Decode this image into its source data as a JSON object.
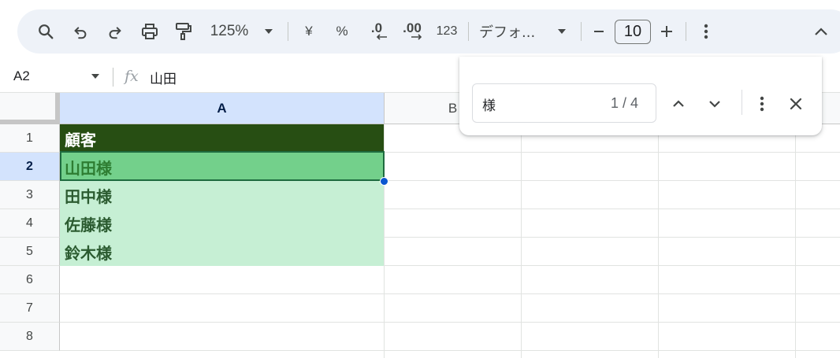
{
  "toolbar": {
    "zoom": "125%",
    "currency_label": "¥",
    "percent_label": "%",
    "decrease_decimal_label": ".0",
    "increase_decimal_label": ".00",
    "number_format_label": "123",
    "font_name": "デフォ...",
    "font_size": "10"
  },
  "formula_bar": {
    "cell_ref": "A2",
    "fx_label": "fx",
    "value": "山田"
  },
  "grid": {
    "columns": [
      "A",
      "B"
    ],
    "rows": [
      "1",
      "2",
      "3",
      "4",
      "5",
      "6",
      "7",
      "8"
    ],
    "selected_cell": "A2",
    "cells": [
      "顧客",
      "山田様",
      "田中様",
      "佐藤様",
      "鈴木様"
    ]
  },
  "find": {
    "query": "様",
    "match_count": "1 / 4"
  },
  "colors": {
    "header_fill": "#274e13",
    "match_fill": "#c6efd4",
    "current_match_fill": "#73d08b",
    "selection_accent": "#0b57d0"
  }
}
